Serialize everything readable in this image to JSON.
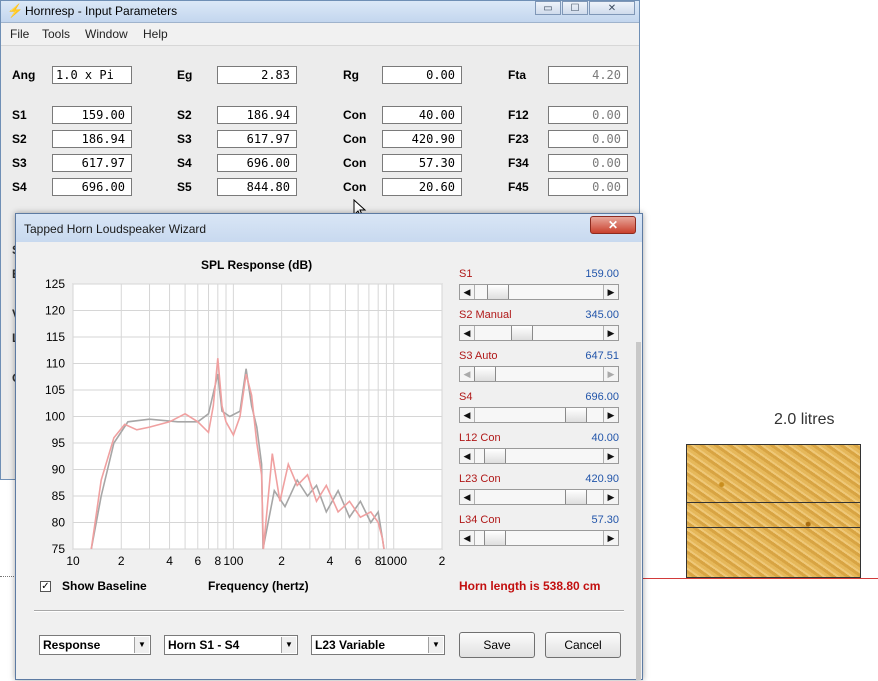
{
  "main_window": {
    "title": "Hornresp - Input Parameters",
    "controls": {
      "minimize": "▭",
      "maximize": "☐",
      "close": "✕"
    },
    "menu": [
      "File",
      "Tools",
      "Window",
      "Help"
    ],
    "params": {
      "Ang": "1.0 x Pi",
      "Eg": "2.83",
      "Rg": "0.00",
      "Fta": "4.20",
      "row1": {
        "S1": "159.00",
        "S2": "186.94",
        "Con": "40.00",
        "F12": "0.00"
      },
      "row2": {
        "S2": "186.94",
        "S3": "617.97",
        "Con": "420.90",
        "F23": "0.00"
      },
      "row3": {
        "S3": "617.97",
        "S4": "696.00",
        "Con": "57.30",
        "F34": "0.00"
      },
      "row4": {
        "S4": "696.00",
        "S5": "844.80",
        "Con": "20.60",
        "F45": "0.00"
      }
    },
    "labels": {
      "ang": "Ang",
      "eg": "Eg",
      "rg": "Rg",
      "fta": "Fta",
      "s1": "S1",
      "s2": "S2",
      "s3": "S3",
      "s4": "S4",
      "s5": "S5",
      "con": "Con",
      "f12": "F12",
      "f23": "F23",
      "f34": "F34",
      "f45": "F45"
    },
    "ghost_letters": [
      "S",
      "E",
      "V",
      "L",
      "O"
    ]
  },
  "dialog": {
    "title": "Tapped Horn Loudspeaker Wizard",
    "close": "✕",
    "show_baseline_label": "Show Baseline",
    "show_baseline_checked": "✓",
    "horn_length": "Horn length is 538.80 cm",
    "dropdowns": [
      "Response",
      "Horn S1 - S4",
      "L23 Variable"
    ],
    "buttons": {
      "save": "Save",
      "cancel": "Cancel"
    },
    "sliders": [
      {
        "label": "S1",
        "value": "159.00",
        "position": 0.12
      },
      {
        "label": "S2  Manual",
        "value": "345.00",
        "position": 0.34
      },
      {
        "label": "S3  Auto",
        "value": "647.51",
        "position": 0.0,
        "disabled": true
      },
      {
        "label": "S4",
        "value": "696.00",
        "position": 0.84
      },
      {
        "label": "L12  Con",
        "value": "40.00",
        "position": 0.09
      },
      {
        "label": "L23  Con",
        "value": "420.90",
        "position": 0.84
      },
      {
        "label": "L34  Con",
        "value": "57.30",
        "position": 0.09
      }
    ]
  },
  "chart_data": {
    "type": "line",
    "title": "SPL Response (dB)",
    "xlabel": "Frequency (hertz)",
    "ylabel": "",
    "x_scale": "log",
    "xlim": [
      10,
      2000
    ],
    "ylim": [
      75,
      125
    ],
    "y_ticks": [
      75,
      80,
      85,
      90,
      95,
      100,
      105,
      110,
      115,
      120,
      125
    ],
    "x_tick_labels": [
      {
        "x": 10,
        "label": "10"
      },
      {
        "x": 20,
        "label": "2"
      },
      {
        "x": 40,
        "label": "4"
      },
      {
        "x": 60,
        "label": "6"
      },
      {
        "x": 80,
        "label": "8"
      },
      {
        "x": 100,
        "label": "100"
      },
      {
        "x": 200,
        "label": "2"
      },
      {
        "x": 400,
        "label": "4"
      },
      {
        "x": 600,
        "label": "6"
      },
      {
        "x": 800,
        "label": "8"
      },
      {
        "x": 1000,
        "label": "1000"
      },
      {
        "x": 2000,
        "label": "2"
      }
    ],
    "grid": true,
    "series": [
      {
        "color": "#a6a6a6",
        "points": [
          [
            13,
            75
          ],
          [
            15,
            85
          ],
          [
            18,
            95
          ],
          [
            22,
            99
          ],
          [
            30,
            99.5
          ],
          [
            45,
            99
          ],
          [
            60,
            99
          ],
          [
            70,
            100.5
          ],
          [
            80,
            108
          ],
          [
            85,
            101
          ],
          [
            95,
            100
          ],
          [
            110,
            101
          ],
          [
            120,
            109
          ],
          [
            130,
            102
          ],
          [
            140,
            98
          ],
          [
            150,
            91
          ],
          [
            153,
            75
          ],
          [
            180,
            86
          ],
          [
            210,
            83
          ],
          [
            250,
            88
          ],
          [
            290,
            85
          ],
          [
            330,
            87
          ],
          [
            380,
            82
          ],
          [
            450,
            86
          ],
          [
            530,
            81
          ],
          [
            620,
            84
          ],
          [
            720,
            80
          ],
          [
            800,
            82
          ],
          [
            850,
            77
          ],
          [
            870,
            75
          ]
        ]
      },
      {
        "color": "#f0a0a0",
        "points": [
          [
            13,
            75
          ],
          [
            15,
            88
          ],
          [
            18,
            96
          ],
          [
            21,
            98.5
          ],
          [
            25,
            97.5
          ],
          [
            30,
            98
          ],
          [
            40,
            99
          ],
          [
            50,
            100.5
          ],
          [
            60,
            99
          ],
          [
            70,
            97
          ],
          [
            75,
            102
          ],
          [
            80,
            111
          ],
          [
            85,
            102
          ],
          [
            90,
            99
          ],
          [
            100,
            96.5
          ],
          [
            110,
            100
          ],
          [
            120,
            108
          ],
          [
            130,
            104
          ],
          [
            140,
            95
          ],
          [
            150,
            89
          ],
          [
            154,
            75
          ],
          [
            175,
            93
          ],
          [
            195,
            84
          ],
          [
            220,
            91
          ],
          [
            250,
            87
          ],
          [
            290,
            89
          ],
          [
            330,
            84
          ],
          [
            380,
            87
          ],
          [
            450,
            82
          ],
          [
            530,
            84
          ],
          [
            620,
            81
          ],
          [
            720,
            82
          ],
          [
            800,
            80
          ],
          [
            850,
            77
          ],
          [
            870,
            75
          ]
        ]
      }
    ]
  },
  "box_render": {
    "label": "2.0 litres"
  }
}
